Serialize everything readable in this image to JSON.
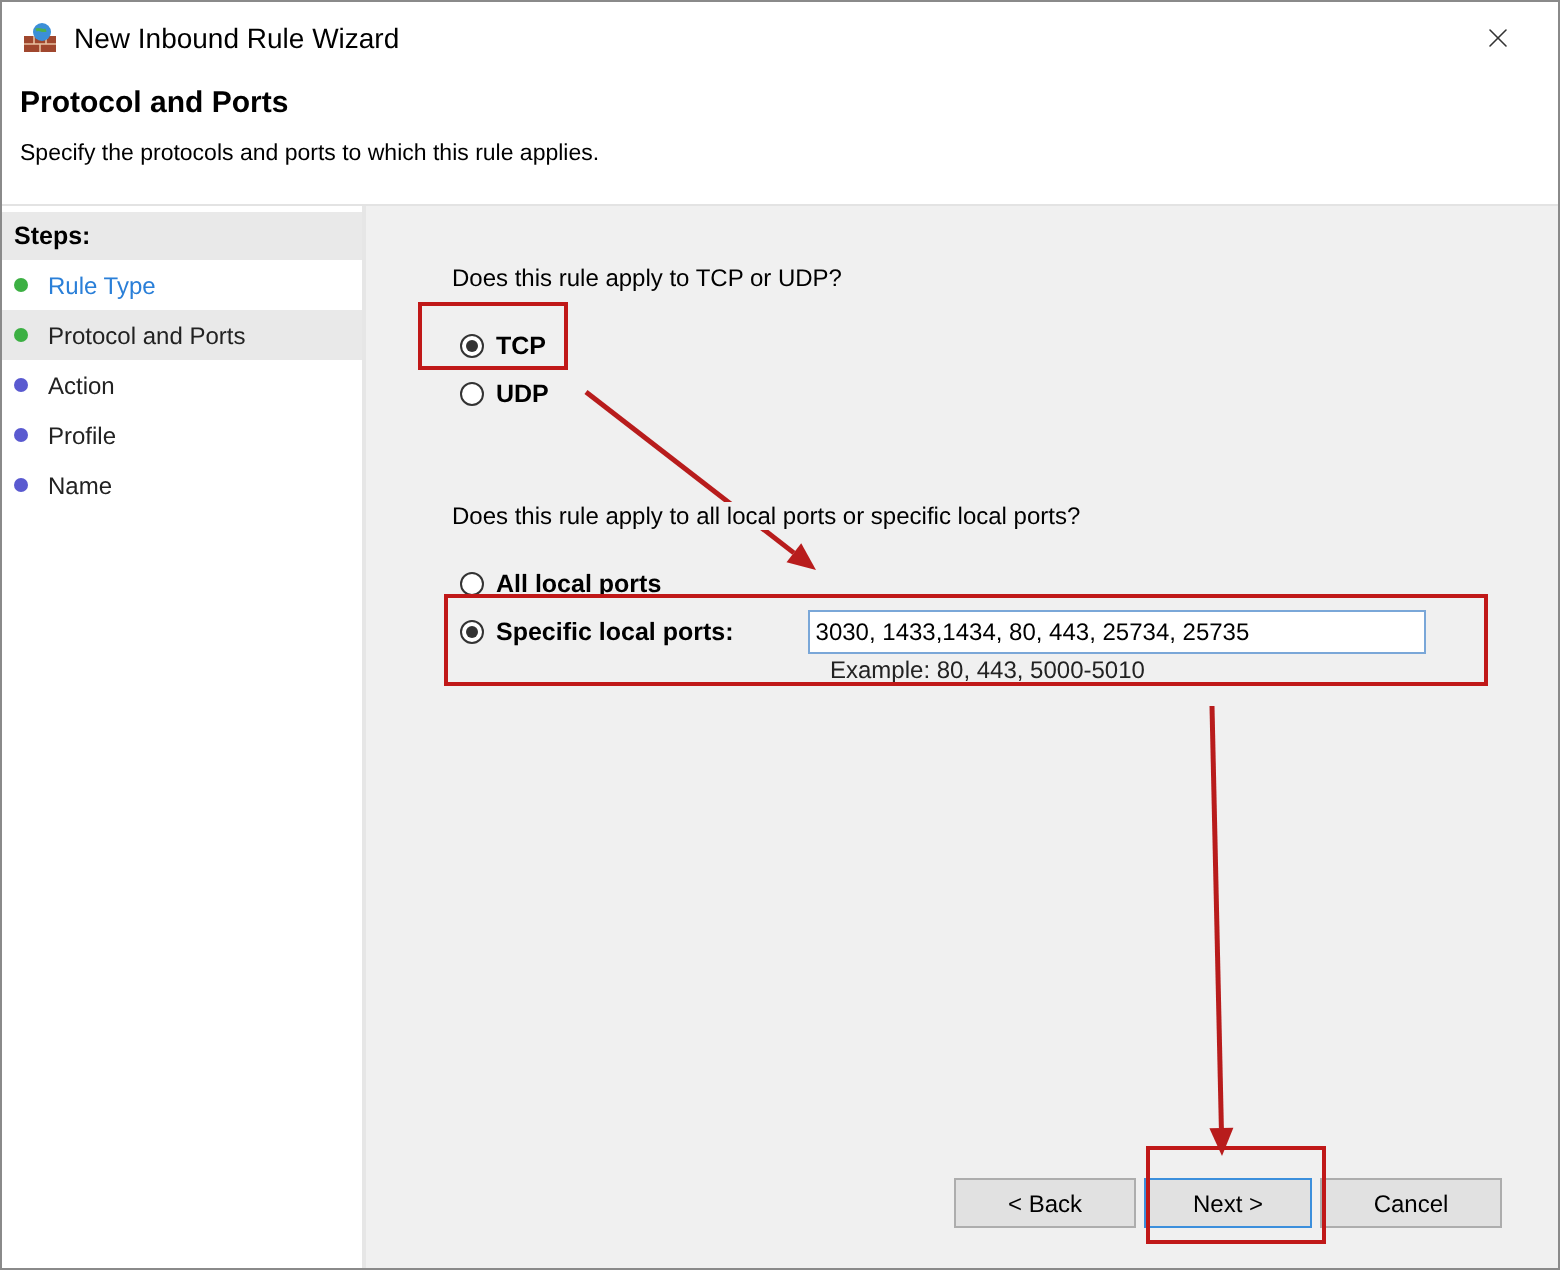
{
  "window": {
    "title": "New Inbound Rule Wizard"
  },
  "header": {
    "title": "Protocol and Ports",
    "subtitle": "Specify the protocols and ports to which this rule applies."
  },
  "steps": {
    "heading": "Steps:",
    "items": [
      {
        "label": "Rule Type",
        "selected": false,
        "link": true,
        "color": "#3cb043"
      },
      {
        "label": "Protocol and Ports",
        "selected": true,
        "link": false,
        "color": "#3cb043"
      },
      {
        "label": "Action",
        "selected": false,
        "link": false,
        "color": "#5a5ad0"
      },
      {
        "label": "Profile",
        "selected": false,
        "link": false,
        "color": "#5a5ad0"
      },
      {
        "label": "Name",
        "selected": false,
        "link": false,
        "color": "#5a5ad0"
      }
    ]
  },
  "protocol": {
    "question": "Does this rule apply to TCP or UDP?",
    "options": [
      {
        "label": "TCP",
        "selected": true
      },
      {
        "label": "UDP",
        "selected": false
      }
    ]
  },
  "ports": {
    "question": "Does this rule apply to all local ports or specific local ports?",
    "options": [
      {
        "label": "All local ports",
        "selected": false
      },
      {
        "label": "Specific local ports:",
        "selected": true
      }
    ],
    "value": "3030, 1433,1434, 80, 443, 25734, 25735",
    "example": "Example: 80, 443, 5000-5010"
  },
  "buttons": [
    {
      "label": "< Back",
      "default": false
    },
    {
      "label": "Next >",
      "default": true
    },
    {
      "label": "Cancel",
      "default": false
    }
  ]
}
